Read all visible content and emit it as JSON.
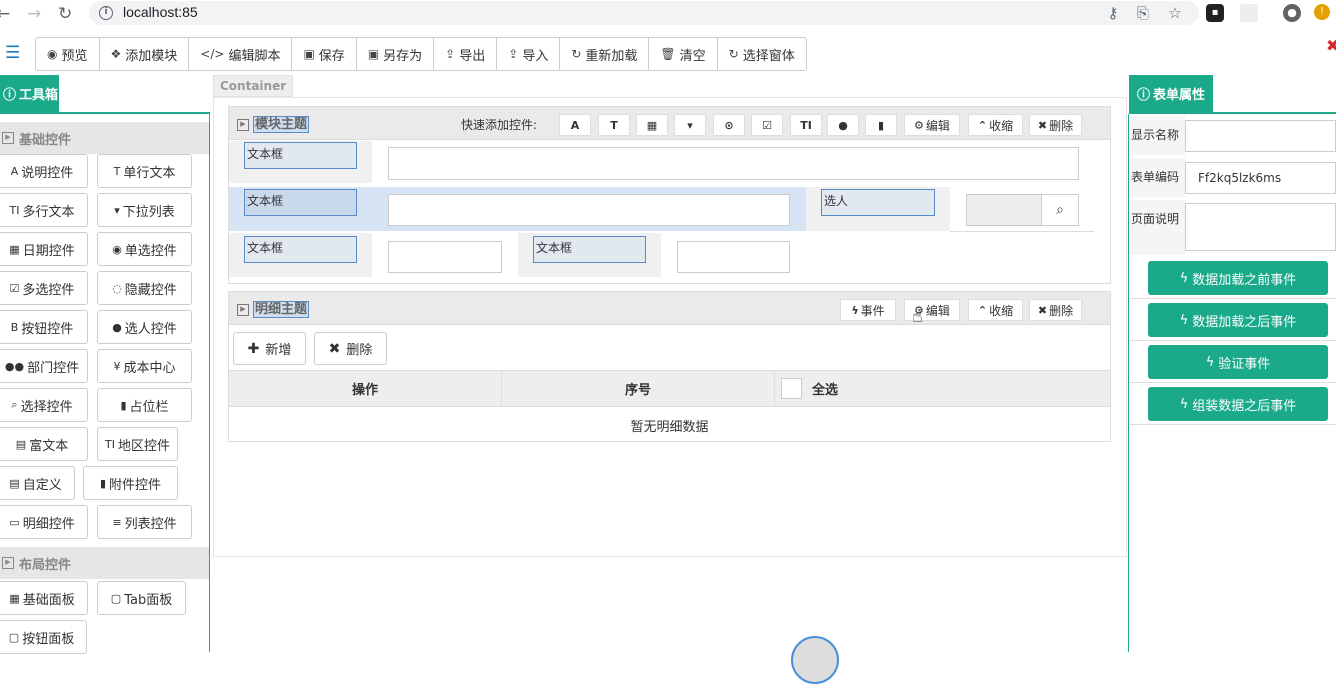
{
  "browser": {
    "url": "localhost:85"
  },
  "toolbar": {
    "buttons": [
      {
        "icon": "eye-icon",
        "glyph": "◉",
        "label": "预览"
      },
      {
        "icon": "cubes-icon",
        "glyph": "❖",
        "label": "添加模块"
      },
      {
        "icon": "code-icon",
        "glyph": "</>",
        "label": "编辑脚本"
      },
      {
        "icon": "save-icon",
        "glyph": "▣",
        "label": "保存"
      },
      {
        "icon": "save-as-icon",
        "glyph": "▣",
        "label": "另存为"
      },
      {
        "icon": "export-icon",
        "glyph": "⇪",
        "label": "导出"
      },
      {
        "icon": "import-icon",
        "glyph": "⇪",
        "label": "导入"
      },
      {
        "icon": "reload-icon",
        "glyph": "↻",
        "label": "重新加载"
      },
      {
        "icon": "trash-icon",
        "glyph": "🗑",
        "label": "清空"
      },
      {
        "icon": "select-form-icon",
        "glyph": "↻",
        "label": "选择窗体"
      }
    ]
  },
  "toolbox": {
    "title": "工具箱",
    "basic_section": "基础控件",
    "basic_controls": [
      {
        "icon": "font-icon",
        "glyph": "A",
        "label": "说明控件"
      },
      {
        "icon": "text-icon",
        "glyph": "T",
        "label": "单行文本"
      },
      {
        "icon": "multiline-icon",
        "glyph": "TI",
        "label": "多行文本"
      },
      {
        "icon": "dropdown-icon",
        "glyph": "▾",
        "label": "下拉列表"
      },
      {
        "icon": "calendar-icon",
        "glyph": "▦",
        "label": "日期控件"
      },
      {
        "icon": "radio-icon",
        "glyph": "◉",
        "label": "单选控件"
      },
      {
        "icon": "checkbox-icon",
        "glyph": "☑",
        "label": "多选控件"
      },
      {
        "icon": "hidden-icon",
        "glyph": "◌",
        "label": "隐藏控件"
      },
      {
        "icon": "bold-icon",
        "glyph": "B",
        "label": "按钮控件"
      },
      {
        "icon": "user-icon",
        "glyph": "●",
        "label": "选人控件"
      },
      {
        "icon": "group-icon",
        "glyph": "●●",
        "label": "部门控件"
      },
      {
        "icon": "yen-icon",
        "glyph": "¥",
        "label": "成本中心"
      },
      {
        "icon": "search-icon",
        "glyph": "⌕",
        "label": "选择控件"
      },
      {
        "icon": "bookmark-icon",
        "glyph": "▮",
        "label": "占位栏"
      },
      {
        "icon": "richtext-icon",
        "glyph": "▤",
        "label": "富文本"
      },
      {
        "icon": "region-icon",
        "glyph": "TI",
        "label": "地区控件"
      },
      {
        "icon": "custom-icon",
        "glyph": "▤",
        "label": "自定义"
      },
      {
        "icon": "file-icon",
        "glyph": "▮",
        "label": "附件控件"
      },
      {
        "icon": "detail-icon",
        "glyph": "▭",
        "label": "明细控件"
      },
      {
        "icon": "list-icon",
        "glyph": "≡",
        "label": "列表控件"
      }
    ],
    "layout_section": "布局控件",
    "layout_controls": [
      {
        "icon": "grid-icon",
        "glyph": "▦",
        "label": "基础面板"
      },
      {
        "icon": "tab-icon",
        "glyph": "▢",
        "label": "Tab面板"
      },
      {
        "icon": "button-panel-icon",
        "glyph": "▢",
        "label": "按钮面板"
      }
    ]
  },
  "canvas": {
    "container_label": "Container",
    "module": {
      "title": "模块主题",
      "quick_add_label": "快速添加控件:",
      "quick_icons": [
        {
          "icon": "font-icon",
          "glyph": "A"
        },
        {
          "icon": "text-icon",
          "glyph": "T"
        },
        {
          "icon": "calendar-icon",
          "glyph": "▦"
        },
        {
          "icon": "dropdown-icon",
          "glyph": "▾"
        },
        {
          "icon": "radio-icon",
          "glyph": "⊙"
        },
        {
          "icon": "checkbox-icon",
          "glyph": "☑"
        },
        {
          "icon": "multiline-icon",
          "glyph": "TI"
        },
        {
          "icon": "user-icon",
          "glyph": "●"
        },
        {
          "icon": "bookmark-icon",
          "glyph": "▮"
        }
      ],
      "edit_label": "编辑",
      "collapse_label": "收缩",
      "delete_label": "删除",
      "field_labels": [
        "文本框",
        "文本框",
        "选人",
        "文本框",
        "文本框"
      ]
    },
    "detail": {
      "title": "明细主题",
      "event_label": "事件",
      "edit_label": "编辑",
      "collapse_label": "收缩",
      "delete_label": "删除",
      "add_label": "新增",
      "remove_label": "删除",
      "columns": [
        "操作",
        "序号",
        "全选"
      ],
      "empty_text": "暂无明细数据"
    }
  },
  "properties": {
    "title": "表单属性",
    "fields": [
      {
        "label": "显示名称",
        "value": ""
      },
      {
        "label": "表单编码",
        "value": "Ff2kq5lzk6ms"
      },
      {
        "label": "页面说明",
        "value": ""
      }
    ],
    "events": [
      "数据加载之前事件",
      "数据加载之后事件",
      "验证事件",
      "组装数据之后事件"
    ]
  },
  "colors": {
    "accent": "#1aaa8a",
    "selection": "#5a8bc8"
  }
}
